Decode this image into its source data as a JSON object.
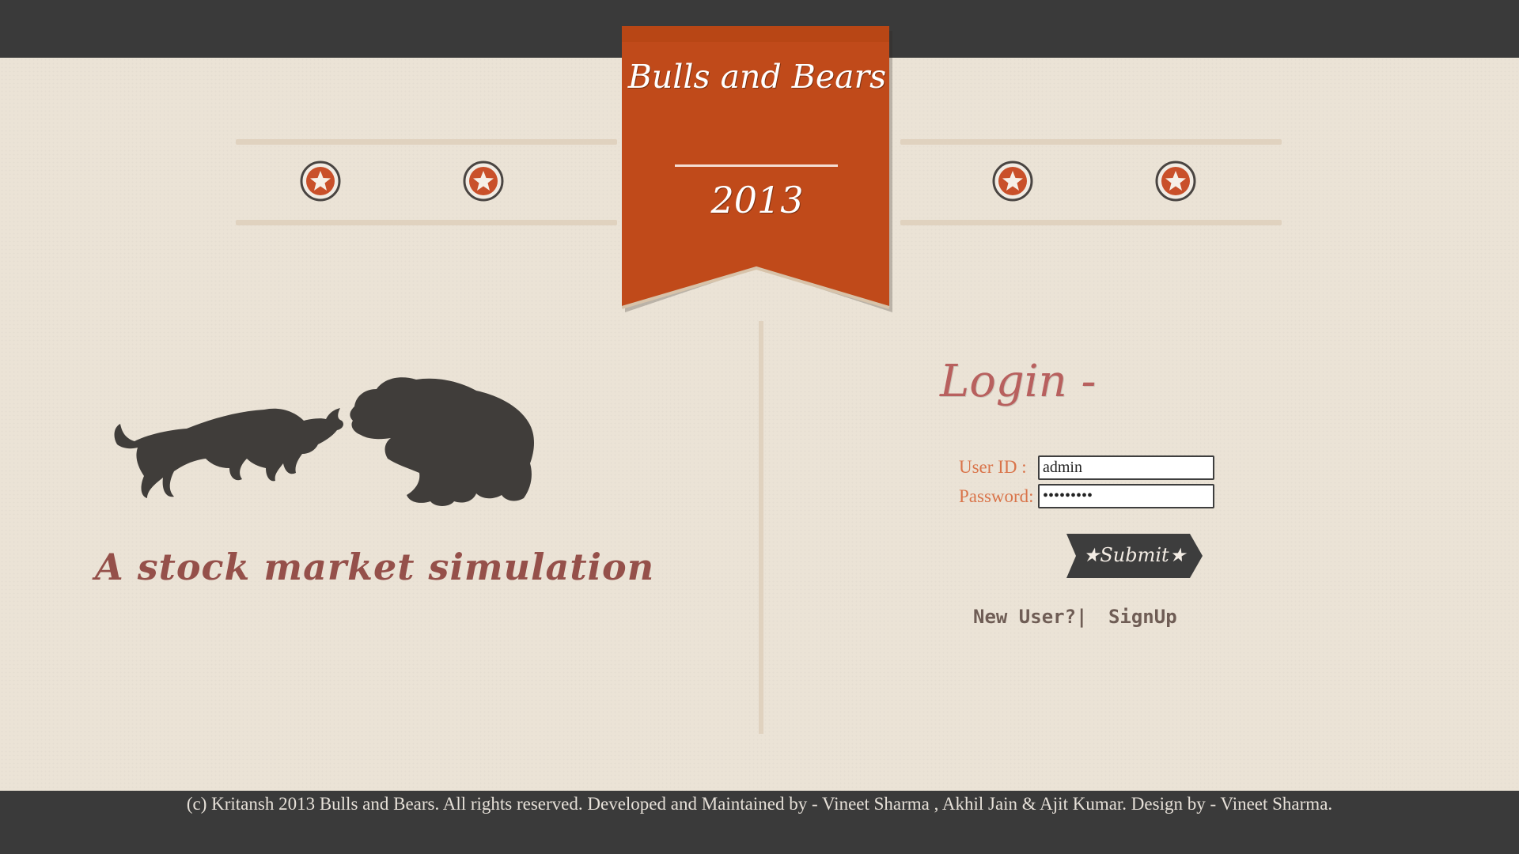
{
  "banner": {
    "title": "Bulls and Bears",
    "year": "2013",
    "ribbon_color": "#c04a1a"
  },
  "decorations": {
    "star_icon": "star-in-circle-icon",
    "star_color": "#c9502a",
    "star_count": 4
  },
  "hero": {
    "image_icon": "bull-and-bear-silhouette-icon",
    "tagline": "A stock market simulation"
  },
  "login": {
    "heading": "Login -",
    "user_id_label": "User ID :",
    "user_id_value": "admin",
    "password_label": "Password:",
    "password_value": "•••••••••",
    "submit_label": "★Submit★",
    "new_user_text": "New User?|",
    "signup_text": "SignUp"
  },
  "footer": {
    "text": "(c) Kritansh 2013 Bulls and Bears. All rights reserved. Developed and Maintained by - Vineet Sharma , Akhil Jain & Ajit Kumar. Design by - Vineet Sharma."
  },
  "colors": {
    "background": "#ebe3d6",
    "dark_bar": "#3a3a3a",
    "accent": "#c04a1a",
    "label": "#d9744a"
  }
}
